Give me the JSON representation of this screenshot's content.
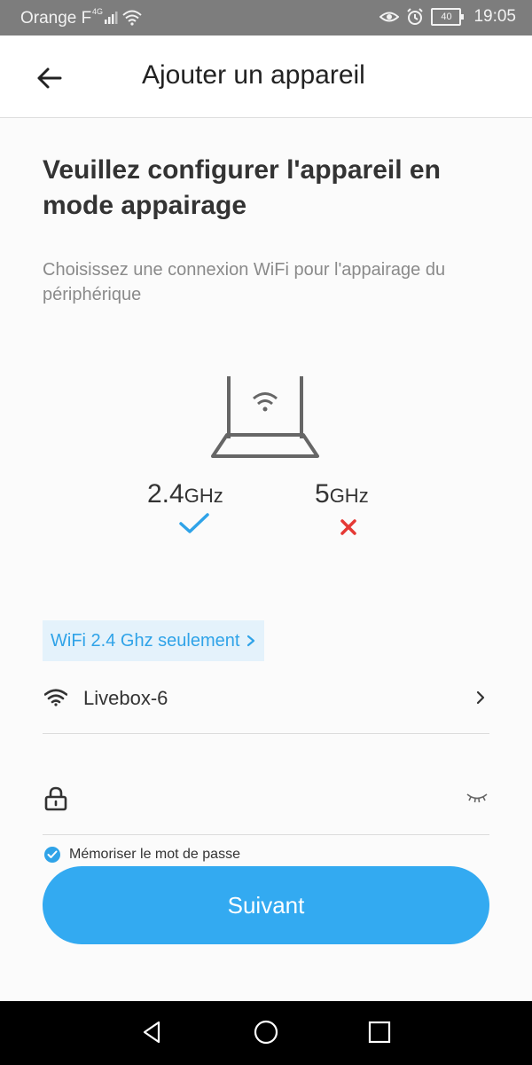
{
  "status_bar": {
    "carrier": "Orange F",
    "network": "4G",
    "battery": "40",
    "time": "19:05"
  },
  "header": {
    "title": "Ajouter un appareil"
  },
  "main": {
    "heading": "Veuillez configurer l'appareil en mode appairage",
    "subtitle": "Choisissez une connexion WiFi pour l'appairage du périphérique",
    "band_24": {
      "value": "2.4",
      "unit": "GHz",
      "supported": true
    },
    "band_5": {
      "value": "5",
      "unit": "GHz",
      "supported": false
    },
    "wifi_only_label": "WiFi 2.4 Ghz seulement",
    "ssid": "Livebox-6",
    "password": {
      "value": "",
      "placeholder": ""
    },
    "remember_label": "Mémoriser le mot de passe",
    "remember_checked": true,
    "next_label": "Suivant"
  },
  "colors": {
    "accent": "#33aaf1",
    "chip_bg": "#e4f2fb",
    "error": "#e53935",
    "status_bar": "#7d7d7d"
  }
}
